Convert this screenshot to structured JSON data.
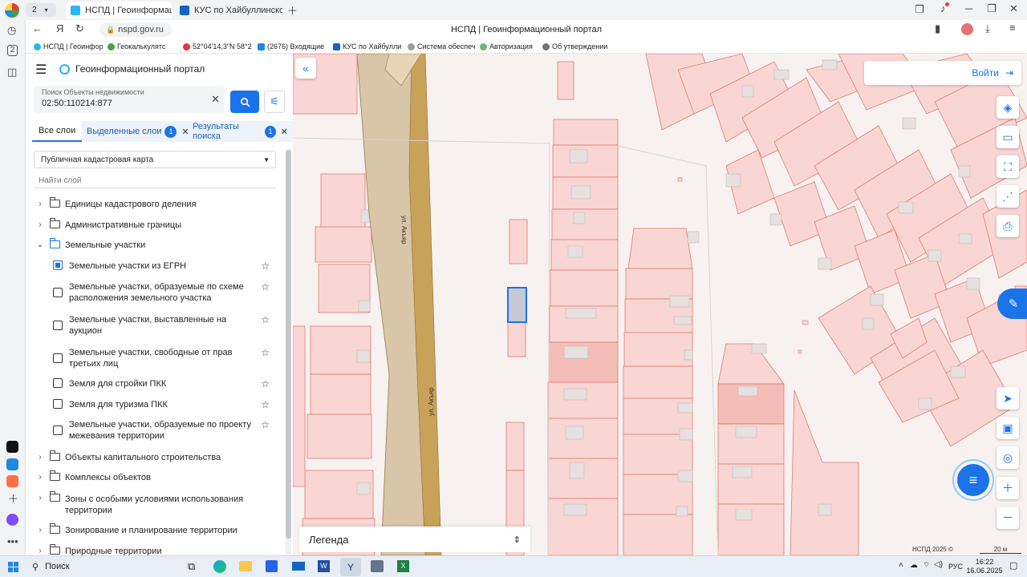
{
  "browser": {
    "tab_counter": "2",
    "tabs": [
      {
        "title": "НСПД | Геоинформацио",
        "active": true
      },
      {
        "title": "КУС по Хайбуллинскому р",
        "active": false
      }
    ],
    "page_title": "НСПД | Геоинформационный портал",
    "url": "nspd.gov.ru",
    "bookmarks": [
      "НСПД | Геоинфор",
      "Геокалькулятс",
      "52°04'14,3\"N 58°2",
      "(2676) Входящие",
      "КУС по Хайбулли",
      "Система обеспеч",
      "Авторизация",
      "Об утверждении"
    ]
  },
  "portal": {
    "title": "Геоинформационный портал",
    "search_label": "Поиск Объекты недвижимости",
    "search_value": "02:50:110214:877",
    "tabs": [
      {
        "label": "Все слои",
        "badge": ""
      },
      {
        "label": "Выделенные слои",
        "badge": "1"
      },
      {
        "label": "Результаты поиска",
        "badge": "1"
      }
    ],
    "basemap": "Публичная кадастровая карта",
    "find_layer_placeholder": "Найти слой",
    "tree": {
      "top_groups": [
        "Единицы кадастрового деления",
        "Административные границы"
      ],
      "open_group": "Земельные участки",
      "layers": [
        {
          "l1": "Земельные участки из ЕГРН",
          "l2": "",
          "checked": true
        },
        {
          "l1": "Земельные участки, образуемые по схеме",
          "l2": "расположения земельного участка",
          "checked": false
        },
        {
          "l1": "Земельные участки, выставленные на",
          "l2": "аукцион",
          "checked": false
        },
        {
          "l1": "Земельные участки, свободные от прав",
          "l2": "третьих лиц",
          "checked": false
        },
        {
          "l1": "Земля для стройки ПКК",
          "l2": "",
          "checked": false
        },
        {
          "l1": "Земля для туризма ПКК",
          "l2": "",
          "checked": false
        },
        {
          "l1": "Земельные участки, образуемые по проекту",
          "l2": "межевания территории",
          "checked": false
        }
      ],
      "bottom_groups": [
        {
          "l1": "Объекты капитального строительства",
          "l2": ""
        },
        {
          "l1": "Комплексы объектов",
          "l2": ""
        },
        {
          "l1": "Зоны с особыми условиями использования",
          "l2": "территории"
        },
        {
          "l1": "Зонирование и планирование территории",
          "l2": ""
        },
        {
          "l1": "Природные территории",
          "l2": ""
        }
      ]
    }
  },
  "map": {
    "login_label": "Войти",
    "legend_label": "Легенда",
    "street_labels": [
      "ул. Акъяр",
      "ул. Акъяр"
    ],
    "copyright": "НСПД 2025 ©",
    "scale": "20 м",
    "colors": {
      "parcel_fill": "#f9d6d3",
      "parcel_stroke": "#e07a72",
      "road": "#c9a25a",
      "selected": "#1a73e8"
    }
  },
  "taskbar": {
    "search": "Поиск",
    "lang": "РУС",
    "time": "16:22",
    "date": "16.06.2025"
  }
}
